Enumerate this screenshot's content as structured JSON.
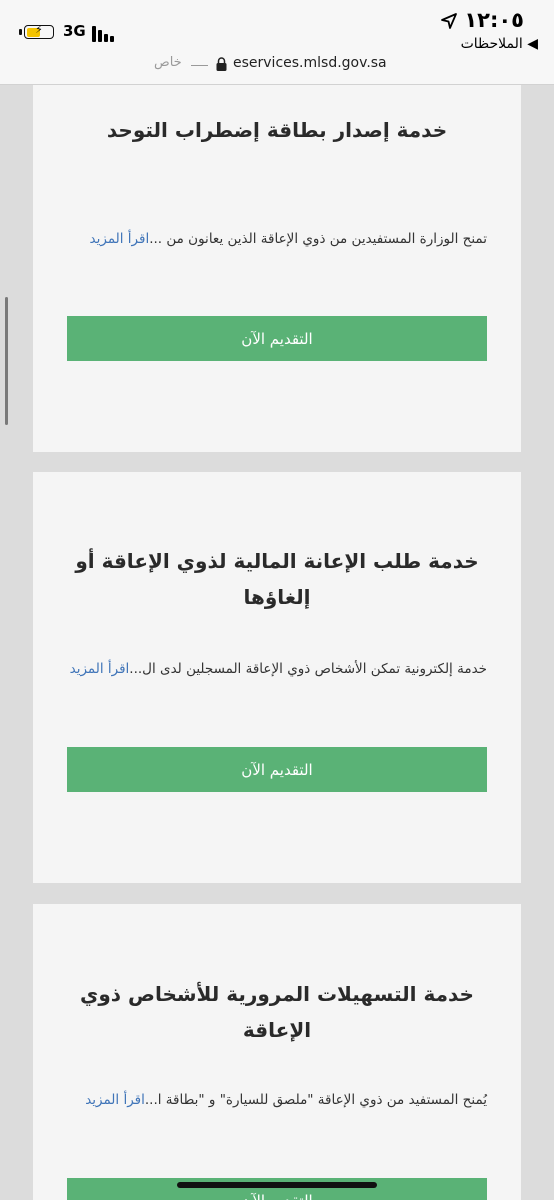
{
  "status_bar": {
    "time": "١٢:٠٥",
    "back_label": "◀ الملاحظات",
    "network": "3G",
    "battery_level": 0.55,
    "battery_color": "#f5c400",
    "icons": [
      "location-arrow-icon",
      "battery-icon",
      "signal-bars-icon"
    ]
  },
  "browser": {
    "private_label": "خاص",
    "url": "eservices.mlsd.gov.sa",
    "icons": [
      "lock-icon"
    ]
  },
  "services": [
    {
      "title": "خدمة إصدار بطاقة إضطراب التوحد",
      "description": "تمنح الوزارة المستفيدين من ذوي الإعاقة الذين يعانون من ...",
      "read_more": "اقرأ المزيد",
      "apply_label": "التقديم الآن"
    },
    {
      "title": "خدمة طلب الإعانة المالية لذوي الإعاقة أو إلغاؤها",
      "description": "خدمة إلكترونية تمكن الأشخاص ذوي الإعاقة المسجلين لدى ال...",
      "read_more": "اقرأ المزيد",
      "apply_label": "التقديم الآن"
    },
    {
      "title": "خدمة التسهيلات المرورية للأشخاص ذوي الإعاقة",
      "description": "يُمنح المستفيد من ذوي الإعاقة \"ملصق للسيارة\" و \"بطاقة ا...",
      "read_more": "اقرأ المزيد",
      "apply_label": "التقديم الآن"
    }
  ],
  "theme": {
    "button_color": "#5ab276",
    "link_color": "#3f74b8",
    "card_background": "#f5f5f5",
    "page_background": "#dcdcdc"
  }
}
